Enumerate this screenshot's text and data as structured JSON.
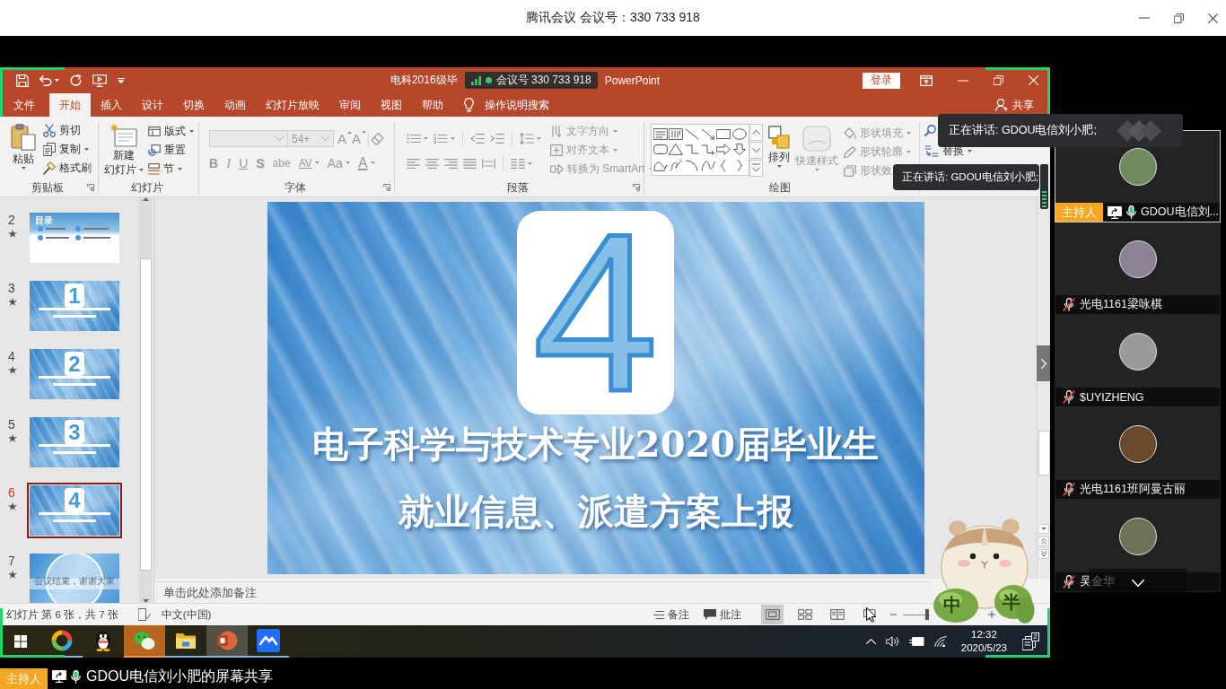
{
  "meeting_window": {
    "title": "腾讯会议 会议号：330 733 918"
  },
  "powerpoint": {
    "title_start": "电科2016级毕",
    "meeting_tag": "会议号 330 733 918",
    "title_end": "PowerPoint",
    "sign_in": "登录",
    "tabs": [
      {
        "label": "文件",
        "selected": false
      },
      {
        "label": "开始",
        "selected": true
      },
      {
        "label": "插入",
        "selected": false
      },
      {
        "label": "设计",
        "selected": false
      },
      {
        "label": "切换",
        "selected": false
      },
      {
        "label": "动画",
        "selected": false
      },
      {
        "label": "幻灯片放映",
        "selected": false
      },
      {
        "label": "审阅",
        "selected": false
      },
      {
        "label": "视图",
        "selected": false
      },
      {
        "label": "帮助",
        "selected": false
      }
    ],
    "tell_me": "操作说明搜索",
    "share": "共享",
    "ribbon": {
      "clipboard": {
        "label": "剪贴板",
        "paste": "粘贴",
        "commands": [
          "剪切",
          "复制",
          "格式刷"
        ]
      },
      "slides": {
        "label": "幻灯片",
        "new_slide": [
          "新建",
          "幻灯片"
        ],
        "commands": [
          "版式",
          "重置",
          "节"
        ]
      },
      "font": {
        "label": "字体",
        "disabled": true,
        "font_size": "54+",
        "size_buttons": [
          "A",
          "A"
        ],
        "format_buttons": [
          "B",
          "I",
          "U",
          "S",
          "abe",
          "AV",
          "Aa",
          "A"
        ]
      },
      "paragraph": {
        "label": "段落",
        "disabled": true,
        "commands": [
          "文字方向",
          "对齐文本",
          "转换为 SmartArt"
        ]
      },
      "drawing": {
        "label": "绘图",
        "arrange": {
          "label": "排列",
          "disabled": false
        },
        "quick_styles": {
          "label": "快速样式",
          "disabled": true
        },
        "commands": [
          {
            "label": "形状填充",
            "disabled": true
          },
          {
            "label": "形状轮廓",
            "disabled": true
          },
          {
            "label": "形状效",
            "disabled": true
          }
        ]
      },
      "editing": {
        "replace": "替换"
      }
    },
    "slides": [
      {
        "number": "2",
        "kind": "contents",
        "title": "目录",
        "selected": false
      },
      {
        "number": "3",
        "kind": "section",
        "title": "1",
        "selected": false
      },
      {
        "number": "4",
        "kind": "section",
        "title": "2",
        "selected": false
      },
      {
        "number": "5",
        "kind": "section",
        "title": "3",
        "selected": false
      },
      {
        "number": "6",
        "kind": "section",
        "title": "4",
        "selected": true
      },
      {
        "number": "7",
        "kind": "ending",
        "title": "会议结束，谢谢大家",
        "selected": false
      }
    ],
    "current_slide": {
      "number": "4",
      "lines": [
        "电子科学与技术专业2020届毕业生",
        "就业信息、派遣方案上报"
      ]
    },
    "notes": {
      "placeholder": "单击此处添加备注"
    },
    "status_bar": {
      "slide_info": "幻灯片 第 6 张，共 7 张",
      "language": "中文(中国)",
      "notes": "备注",
      "comments": "批注",
      "views": [
        {
          "selected": true
        },
        {
          "selected": false
        },
        {
          "selected": false
        },
        {
          "selected": false
        }
      ],
      "zoom": {
        "level": 0.9
      }
    }
  },
  "taskbar": {
    "apps": [
      {
        "running": true,
        "active": false,
        "flashing": false
      },
      {
        "running": false,
        "active": false,
        "flashing": false
      },
      {
        "running": true,
        "active": false,
        "flashing": true
      },
      {
        "running": true,
        "active": false,
        "flashing": false
      },
      {
        "running": true,
        "active": true,
        "flashing": false
      },
      {
        "running": true,
        "active": false,
        "flashing": false
      }
    ],
    "time": "12:32",
    "date": "2020/5/23",
    "notification_count": "2"
  },
  "meeting": {
    "speaking_notices": [
      "正在讲话: GDOU电信刘小肥;",
      "正在讲话: GDOU电信刘小肥;"
    ],
    "participants": [
      {
        "name": "GDOU电信刘...",
        "badge": "主持人",
        "sharing": true,
        "muted": false,
        "speaking": true
      },
      {
        "name": "光电1161梁咏棋",
        "sharing": false,
        "muted": true,
        "speaking": false
      },
      {
        "name": "$UYIZHENG",
        "sharing": false,
        "muted": true,
        "speaking": false
      },
      {
        "name": "光电1161班阿曼古丽",
        "sharing": false,
        "muted": true,
        "speaking": false
      },
      {
        "name": "吴金华",
        "sharing": false,
        "muted": true,
        "speaking": false
      }
    ],
    "presenter_bar": {
      "badge": "主持人",
      "label": "GDOU电信刘小肥的屏幕共享",
      "sharing": true,
      "muted": false
    }
  },
  "sticker": {
    "characters": [
      "中",
      "半"
    ]
  }
}
